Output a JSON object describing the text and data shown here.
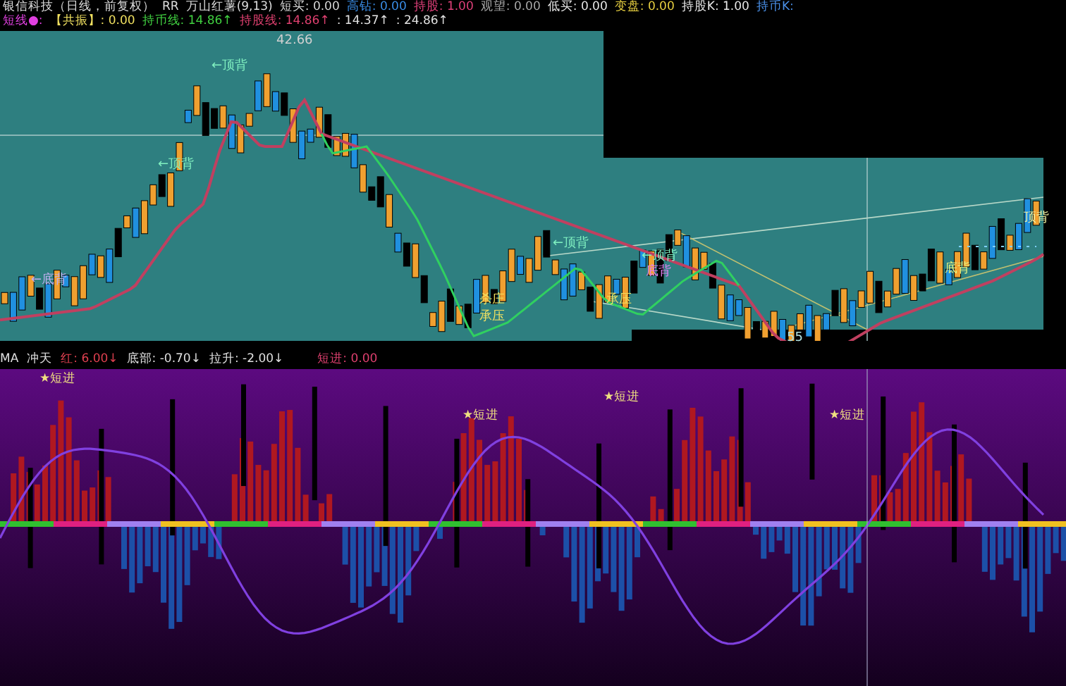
{
  "header": {
    "title": "银信科技（日线，前复权）",
    "code": "RR",
    "indicator": "万山红薯(9,13)",
    "values": [
      {
        "label": "短买:",
        "value": "0.00",
        "color": "#d8d8d8"
      },
      {
        "label": "高钻:",
        "value": "0.00",
        "color": "#3a8ee8"
      },
      {
        "label": "持股:",
        "value": "1.00",
        "color": "#e0407a"
      },
      {
        "label": "观望:",
        "value": "0.00",
        "color": "#a8a8a8"
      },
      {
        "label": "低买:",
        "value": "0.00",
        "color": "#e8e8e8"
      },
      {
        "label": "变盘:",
        "value": "0.00",
        "color": "#e8d040"
      },
      {
        "label": "持股K:",
        "value": "1.00",
        "color": "#e8e8e8"
      },
      {
        "label": "持币K:",
        "color": "#4a90e8"
      }
    ]
  },
  "header_line2": {
    "name": "短线●:",
    "items": [
      {
        "label": "【共振】:",
        "value": "0.00",
        "color": "#f0e060"
      },
      {
        "label": "持币线:",
        "value": "14.86↑",
        "color": "#40d040"
      },
      {
        "label": "持股线:",
        "value": "14.86↑",
        "color": "#e04070"
      },
      {
        "label": ":",
        "value": "14.37↑",
        "color": "#e0e0e0"
      },
      {
        "label": ":",
        "value": "24.86↑",
        "color": "#e0e0e0"
      }
    ]
  },
  "chart": {
    "price_label": "42.66",
    "annotations": [
      {
        "text": "←顶背"
      },
      {
        "text": "←顶背"
      },
      {
        "text": "←底背"
      },
      {
        "text": "杀庄"
      },
      {
        "text": "承压"
      },
      {
        "text": "←顶背"
      },
      {
        "text": "←顶背"
      },
      {
        "text": "底背"
      },
      {
        "text": "承压"
      },
      {
        "text": "55"
      },
      {
        "text": "底背"
      },
      {
        "text": "顶背"
      }
    ]
  },
  "indicator_header": {
    "name": "MA",
    "items": [
      {
        "label": "冲天",
        "color": "#e0e0e0"
      },
      {
        "label": "红:",
        "value": "6.00↓",
        "color": "#e04050"
      },
      {
        "label": "底部:",
        "value": "-0.70↓",
        "color": "#e0e0e0"
      },
      {
        "label": "拉升:",
        "value": "-2.00↓",
        "color": "#e0e0e0"
      },
      {
        "label": "短进:",
        "value": "0.00",
        "color": "#e04070"
      }
    ]
  },
  "indicator": {
    "signals": [
      {
        "text": "★短进"
      },
      {
        "text": "★短进"
      },
      {
        "text": "★短进"
      },
      {
        "text": "★短进"
      }
    ]
  }
}
